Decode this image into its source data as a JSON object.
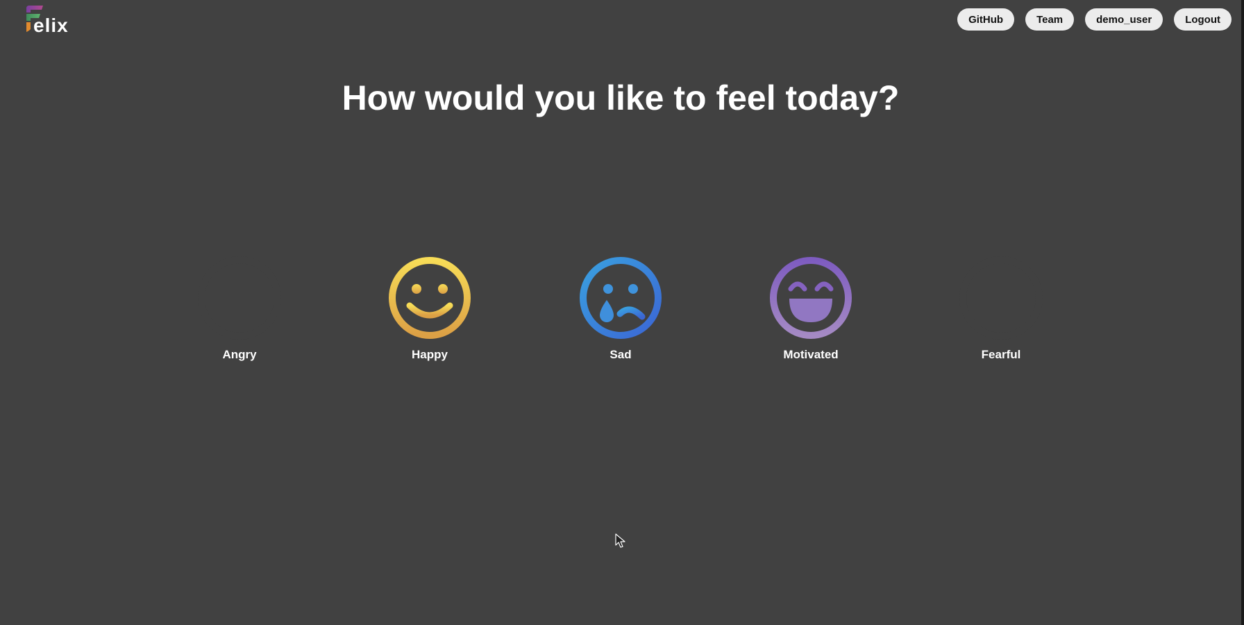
{
  "app": {
    "logo_text": "elix",
    "logo_letter": "F"
  },
  "nav": {
    "items": [
      {
        "label": "GitHub"
      },
      {
        "label": "Team"
      },
      {
        "label": "demo_user"
      },
      {
        "label": "Logout"
      }
    ]
  },
  "main": {
    "heading": "How would you like to feel today?",
    "moods": [
      {
        "label": "Angry",
        "icon": "angry-face-icon",
        "color": ""
      },
      {
        "label": "Happy",
        "icon": "smile-face-icon",
        "color": "#f2c94c"
      },
      {
        "label": "Sad",
        "icon": "crying-face-icon",
        "color": "#3b8be0"
      },
      {
        "label": "Motivated",
        "icon": "grin-face-icon",
        "color": "#8a6bc2"
      },
      {
        "label": "Fearful",
        "icon": "fearful-face-icon",
        "color": ""
      }
    ]
  },
  "colors": {
    "background": "#414141",
    "nav_button": "#ececec",
    "happy_top": "#f7dc57",
    "happy_bottom": "#dca045",
    "sad_top": "#3aa0e0",
    "sad_bottom": "#3b6fd6",
    "motivated_top": "#7e5cc0",
    "motivated_bottom": "#a58ac4"
  }
}
